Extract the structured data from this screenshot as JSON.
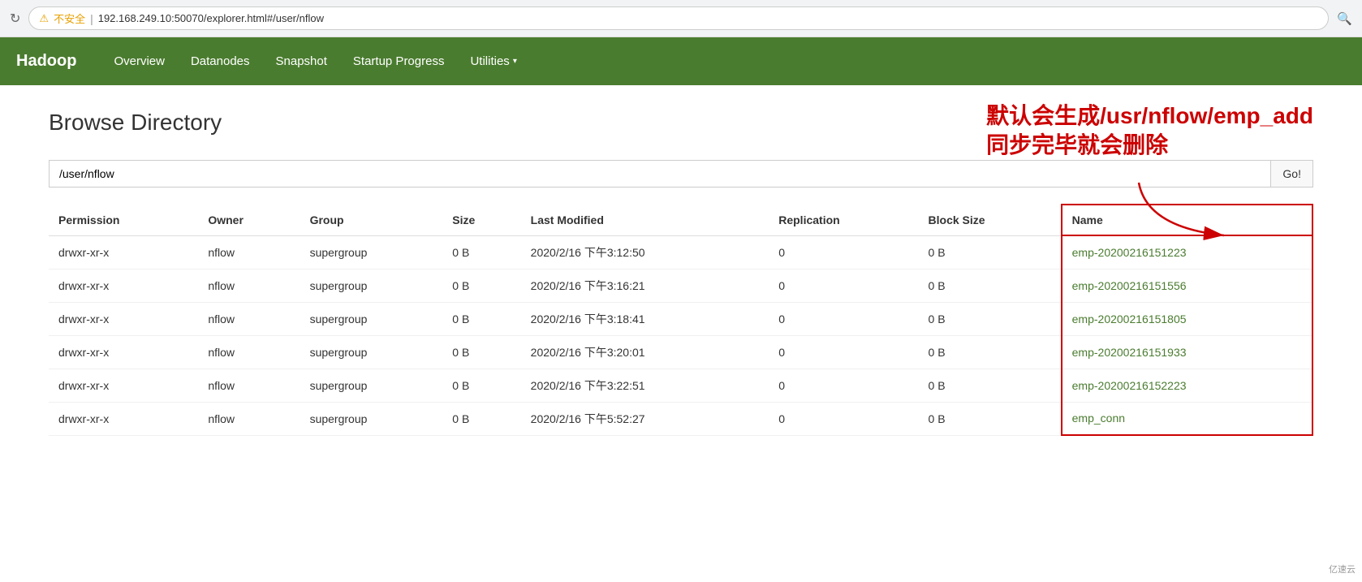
{
  "browser": {
    "reload_label": "↻",
    "warning": "⚠",
    "insecure_label": "不安全",
    "url": "192.168.249.10:50070/explorer.html#/user/nflow",
    "search_icon": "🔍"
  },
  "navbar": {
    "brand": "Hadoop",
    "items": [
      {
        "label": "Overview",
        "dropdown": false
      },
      {
        "label": "Datanodes",
        "dropdown": false
      },
      {
        "label": "Snapshot",
        "dropdown": false
      },
      {
        "label": "Startup Progress",
        "dropdown": false
      },
      {
        "label": "Utilities",
        "dropdown": true
      }
    ]
  },
  "page": {
    "title": "Browse Directory",
    "annotation_line1": "默认会生成/usr/nflow/emp_add",
    "annotation_line2": "同步完毕就会删除",
    "path_value": "/user/nflow",
    "go_label": "Go!",
    "table": {
      "headers": [
        "Permission",
        "Owner",
        "Group",
        "Size",
        "Last Modified",
        "Replication",
        "Block Size",
        "Name"
      ],
      "rows": [
        {
          "permission": "drwxr-xr-x",
          "owner": "nflow",
          "group": "supergroup",
          "size": "0 B",
          "modified": "2020/2/16 下午3:12:50",
          "replication": "0",
          "block_size": "0 B",
          "name": "emp-20200216151223"
        },
        {
          "permission": "drwxr-xr-x",
          "owner": "nflow",
          "group": "supergroup",
          "size": "0 B",
          "modified": "2020/2/16 下午3:16:21",
          "replication": "0",
          "block_size": "0 B",
          "name": "emp-20200216151556"
        },
        {
          "permission": "drwxr-xr-x",
          "owner": "nflow",
          "group": "supergroup",
          "size": "0 B",
          "modified": "2020/2/16 下午3:18:41",
          "replication": "0",
          "block_size": "0 B",
          "name": "emp-20200216151805"
        },
        {
          "permission": "drwxr-xr-x",
          "owner": "nflow",
          "group": "supergroup",
          "size": "0 B",
          "modified": "2020/2/16 下午3:20:01",
          "replication": "0",
          "block_size": "0 B",
          "name": "emp-20200216151933"
        },
        {
          "permission": "drwxr-xr-x",
          "owner": "nflow",
          "group": "supergroup",
          "size": "0 B",
          "modified": "2020/2/16 下午3:22:51",
          "replication": "0",
          "block_size": "0 B",
          "name": "emp-20200216152223"
        },
        {
          "permission": "drwxr-xr-x",
          "owner": "nflow",
          "group": "supergroup",
          "size": "0 B",
          "modified": "2020/2/16 下午5:52:27",
          "replication": "0",
          "block_size": "0 B",
          "name": "emp_conn"
        }
      ]
    }
  },
  "watermark": "亿速云"
}
